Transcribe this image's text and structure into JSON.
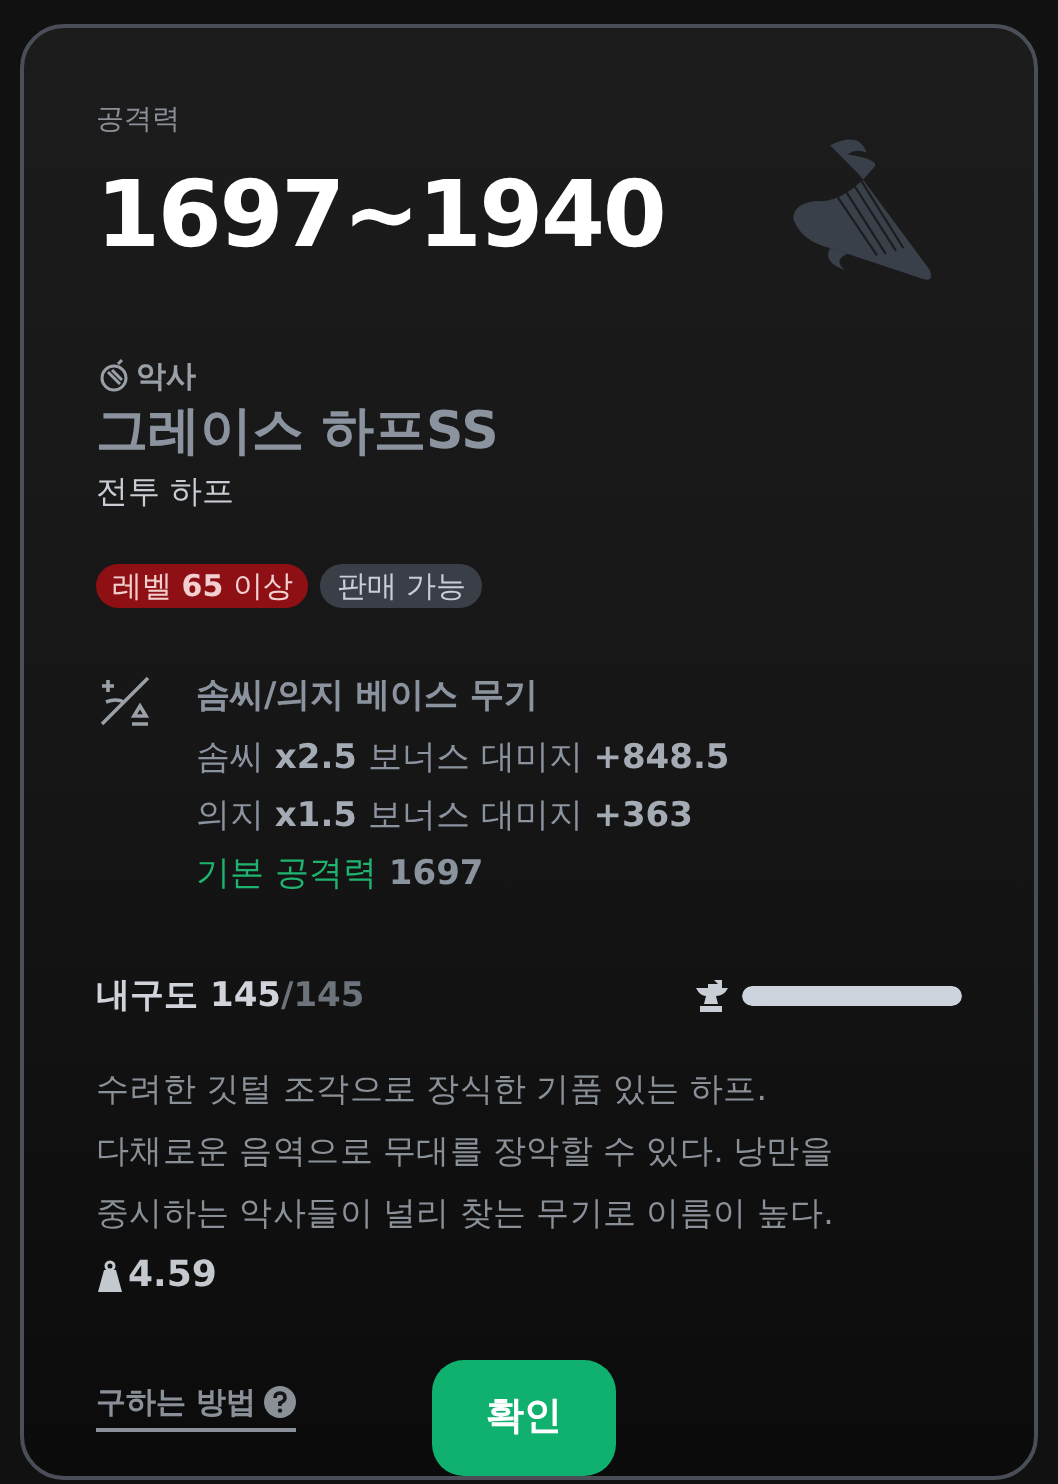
{
  "attack_label": "공격력",
  "attack_value": "1697~1940",
  "class_name": "악사",
  "item_name": "그레이스 하프SS",
  "item_type": "전투 하프",
  "badges": [
    {
      "kind": "level",
      "text": "레벨 **65** 이상"
    },
    {
      "kind": "trade",
      "text": "판매 가능"
    }
  ],
  "base_weapon": {
    "title": "솜씨/의지 베이스 무기",
    "lines": [
      {
        "kind": "bonus",
        "text": "솜씨 **x2.5** 보너스 대미지 **+848.5**"
      },
      {
        "kind": "bonus",
        "text": "의지 **x1.5** 보너스 대미지 **+363**"
      },
      {
        "kind": "base",
        "label": "기본 공격력",
        "value": "1697"
      }
    ]
  },
  "durability": {
    "label": "내구도",
    "current": "145",
    "max": "/145",
    "level": 1
  },
  "description": "수려한 깃털 조각으로 장식한 기품 있는 하프.\n다채로운 음역으로 무대를 장악할 수 있다. 낭만을\n중시하는 악사들이 널리 찾는 무기로 이름이 높다.",
  "weight": "4.59",
  "how_to_get": "구하는 방법",
  "confirm_button": "확인"
}
